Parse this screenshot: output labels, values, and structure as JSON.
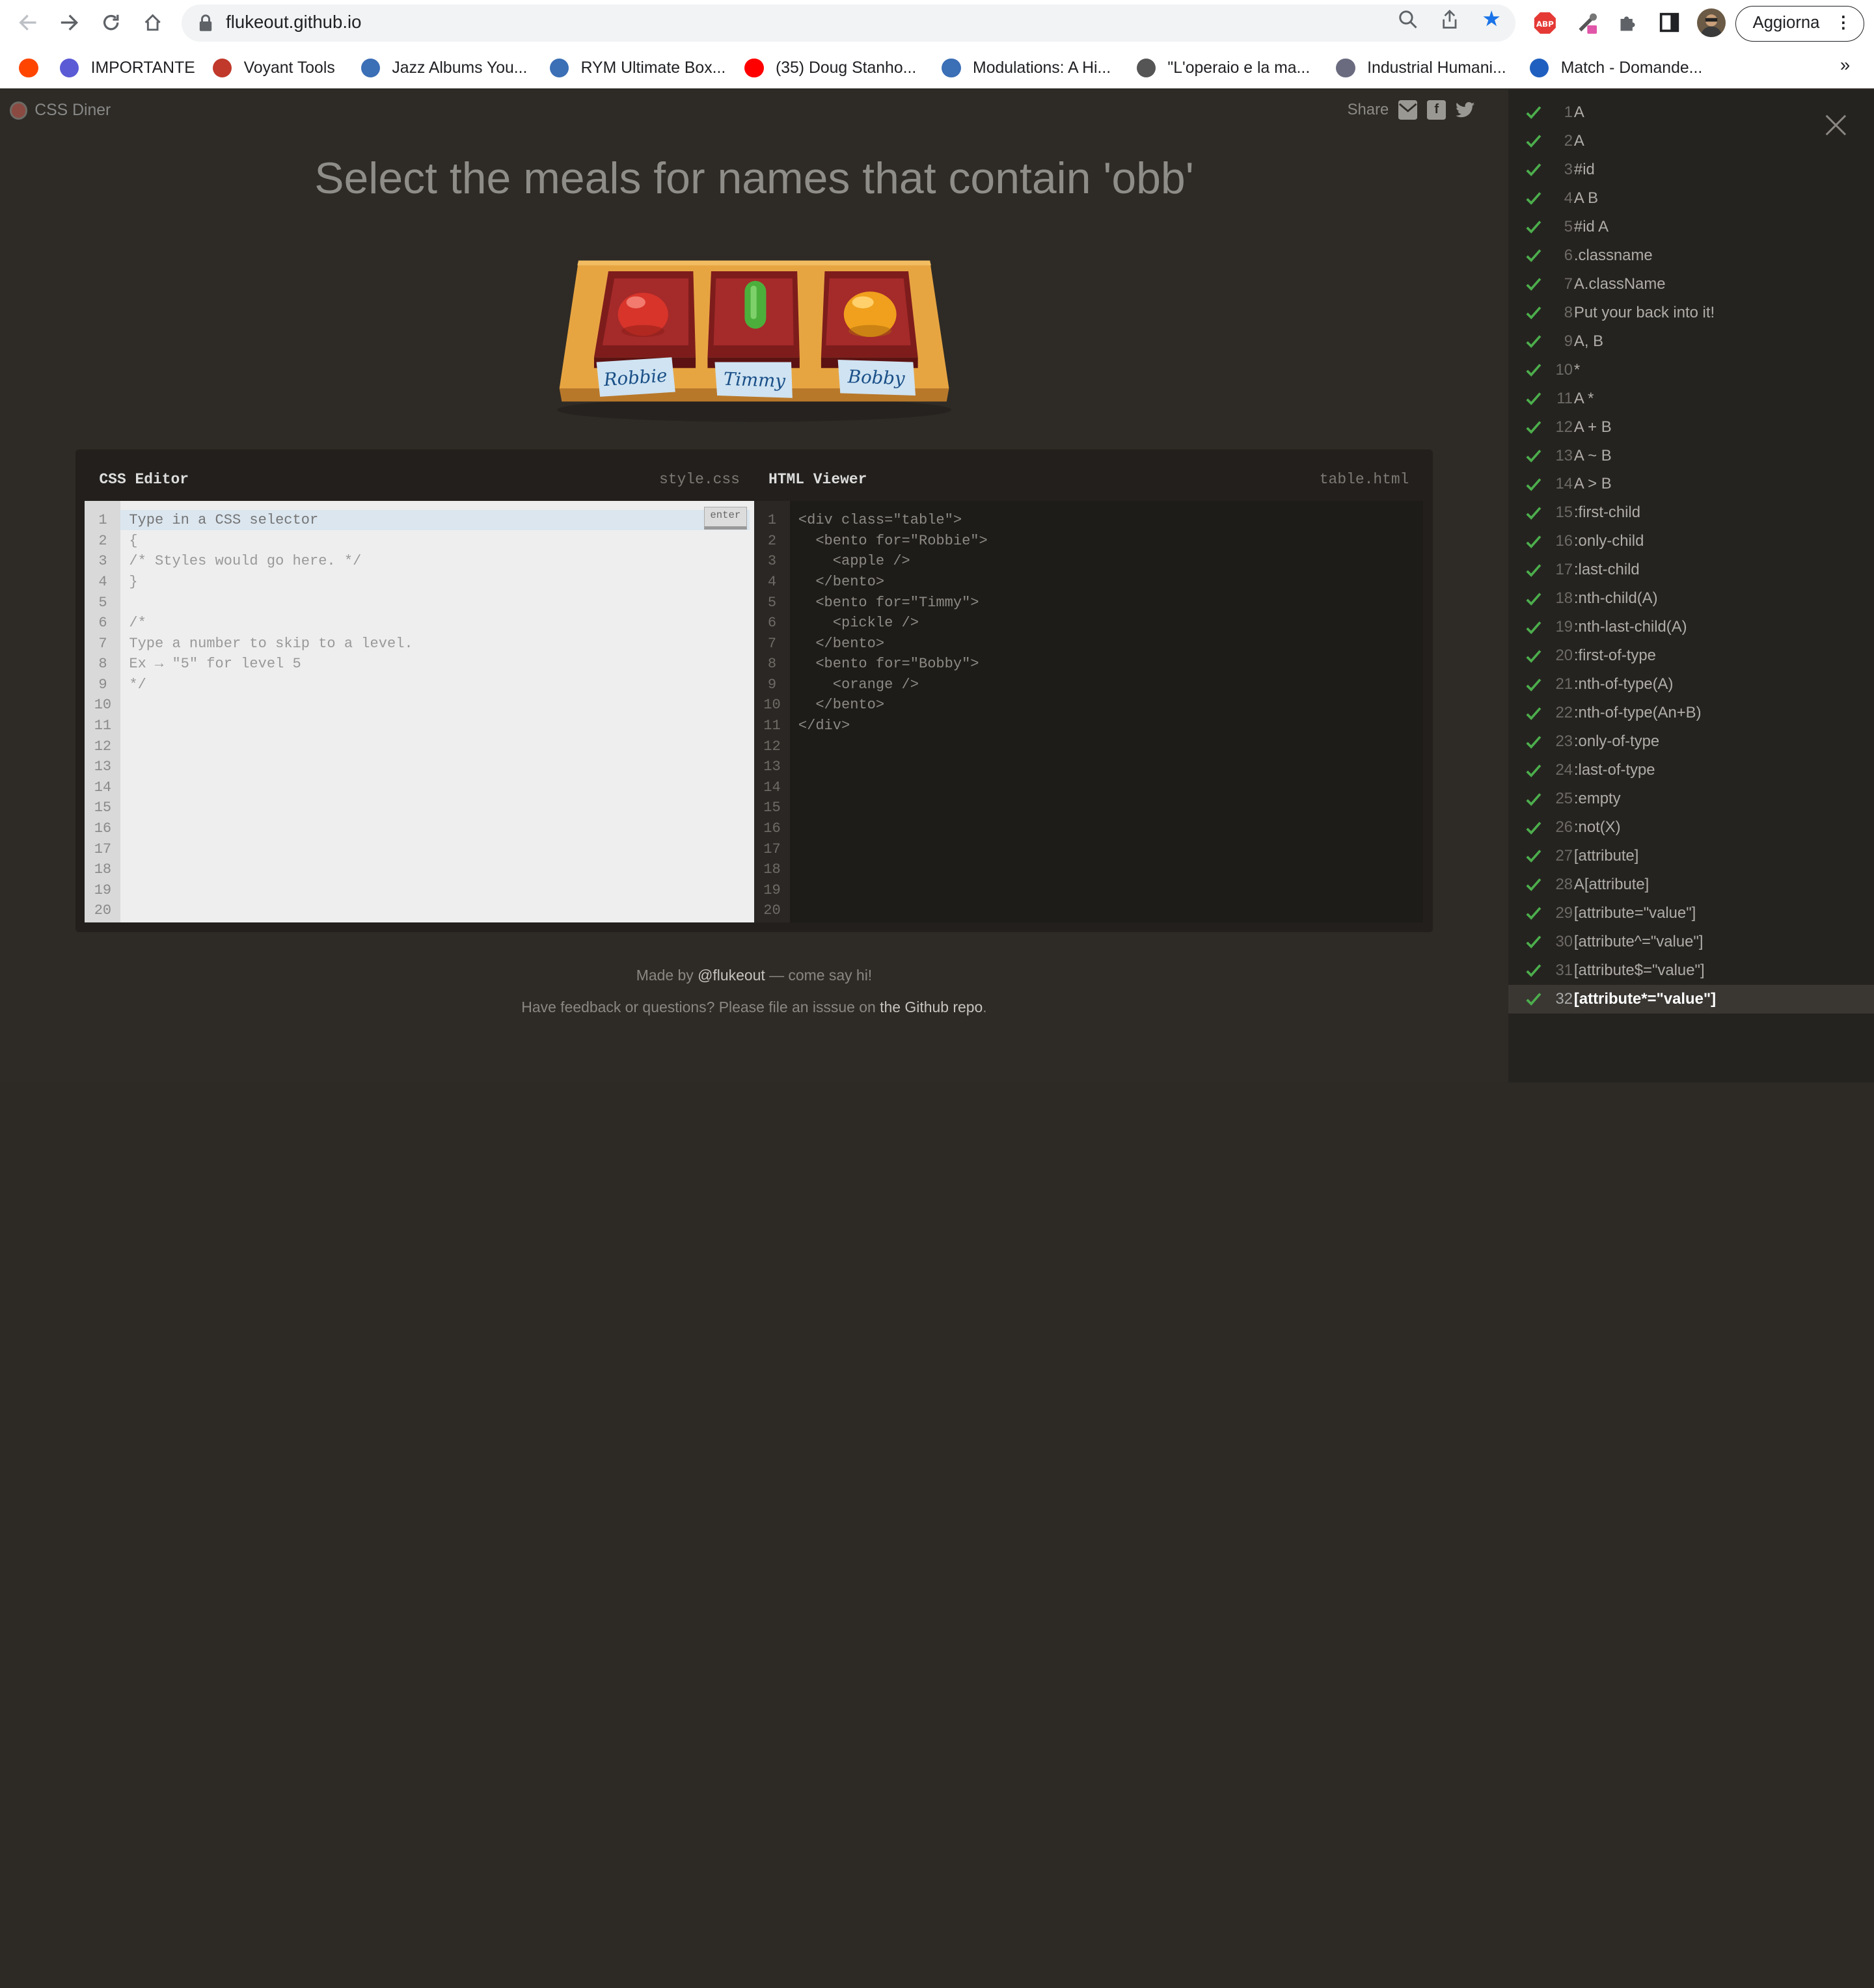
{
  "browser": {
    "url": "flukeout.github.io",
    "update_label": "Aggiorna",
    "more_bookmarks": "»",
    "bookmarks": [
      {
        "label": "",
        "color": "#ff4500"
      },
      {
        "label": "IMPORTANTE",
        "color": "#5b5bd6"
      },
      {
        "label": "Voyant Tools",
        "color": "#c0392b"
      },
      {
        "label": "Jazz Albums You...",
        "color": "#3b6fb6"
      },
      {
        "label": "RYM Ultimate Box...",
        "color": "#3b6fb6"
      },
      {
        "label": "(35) Doug Stanho...",
        "color": "#ff0000"
      },
      {
        "label": "Modulations: A Hi...",
        "color": "#3b6fb6"
      },
      {
        "label": "\"L'operaio e la ma...",
        "color": "#555555"
      },
      {
        "label": "Industrial Humani...",
        "color": "#6b6b80"
      },
      {
        "label": "Match - Domande...",
        "color": "#1f5fbf"
      }
    ]
  },
  "app": {
    "logo_text": "CSS Diner",
    "share_label": "Share",
    "instruction": "Select the meals for names that contain 'obb'",
    "bentos": [
      {
        "name": "Robbie",
        "food": "apple",
        "color": "#d8342a"
      },
      {
        "name": "Timmy",
        "food": "pickle",
        "color": "#4caf3c"
      },
      {
        "name": "Bobby",
        "food": "orange",
        "color": "#f0a01c"
      }
    ]
  },
  "css_editor": {
    "title": "CSS Editor",
    "file": "style.css",
    "placeholder": "Type in a CSS selector",
    "enter_label": "enter",
    "lines": [
      "",
      "{",
      "/* Styles would go here. */",
      "}",
      "",
      "/*",
      "Type a number to skip to a level.",
      "Ex → \"5\" for level 5",
      "*/"
    ],
    "line_numbers": [
      "1",
      "2",
      "3",
      "4",
      "5",
      "6",
      "7",
      "8",
      "9",
      "10",
      "11",
      "12",
      "13",
      "14",
      "15",
      "16",
      "17",
      "18",
      "19",
      "20"
    ]
  },
  "html_viewer": {
    "title": "HTML Viewer",
    "file": "table.html",
    "lines": [
      "<div class=\"table\">",
      "  <bento for=\"Robbie\">",
      "    <apple />",
      "  </bento>",
      "  <bento for=\"Timmy\">",
      "    <pickle />",
      "  </bento>",
      "  <bento for=\"Bobby\">",
      "    <orange />",
      "  </bento>",
      "</div>"
    ],
    "line_numbers": [
      "1",
      "2",
      "3",
      "4",
      "5",
      "6",
      "7",
      "8",
      "9",
      "10",
      "11",
      "12",
      "13",
      "14",
      "15",
      "16",
      "17",
      "18",
      "19",
      "20"
    ]
  },
  "footer": {
    "made_by_prefix": "Made by ",
    "made_by_link": "@flukeout",
    "made_by_suffix": " — come say hi!",
    "feedback_prefix": "Have feedback or questions? Please file an isssue on ",
    "feedback_link": "the Github repo",
    "feedback_suffix": "."
  },
  "levels": {
    "current": 32,
    "check_color": "#4cae4c",
    "items": [
      {
        "num": "1",
        "name": "A"
      },
      {
        "num": "2",
        "name": "A"
      },
      {
        "num": "3",
        "name": "#id"
      },
      {
        "num": "4",
        "name": "A B"
      },
      {
        "num": "5",
        "name": "#id A"
      },
      {
        "num": "6",
        "name": ".classname"
      },
      {
        "num": "7",
        "name": "A.className"
      },
      {
        "num": "8",
        "name": "Put your back into it!"
      },
      {
        "num": "9",
        "name": "A, B"
      },
      {
        "num": "10",
        "name": "*"
      },
      {
        "num": "11",
        "name": "A *"
      },
      {
        "num": "12",
        "name": "A + B"
      },
      {
        "num": "13",
        "name": "A ~ B"
      },
      {
        "num": "14",
        "name": "A > B"
      },
      {
        "num": "15",
        "name": ":first-child"
      },
      {
        "num": "16",
        "name": ":only-child"
      },
      {
        "num": "17",
        "name": ":last-child"
      },
      {
        "num": "18",
        "name": ":nth-child(A)"
      },
      {
        "num": "19",
        "name": ":nth-last-child(A)"
      },
      {
        "num": "20",
        "name": ":first-of-type"
      },
      {
        "num": "21",
        "name": ":nth-of-type(A)"
      },
      {
        "num": "22",
        "name": ":nth-of-type(An+B)"
      },
      {
        "num": "23",
        "name": ":only-of-type"
      },
      {
        "num": "24",
        "name": ":last-of-type"
      },
      {
        "num": "25",
        "name": ":empty"
      },
      {
        "num": "26",
        "name": ":not(X)"
      },
      {
        "num": "27",
        "name": "[attribute]"
      },
      {
        "num": "28",
        "name": "A[attribute]"
      },
      {
        "num": "29",
        "name": "[attribute=\"value\"]"
      },
      {
        "num": "30",
        "name": "[attribute^=\"value\"]"
      },
      {
        "num": "31",
        "name": "[attribute$=\"value\"]"
      },
      {
        "num": "32",
        "name": "[attribute*=\"value\"]"
      }
    ]
  }
}
